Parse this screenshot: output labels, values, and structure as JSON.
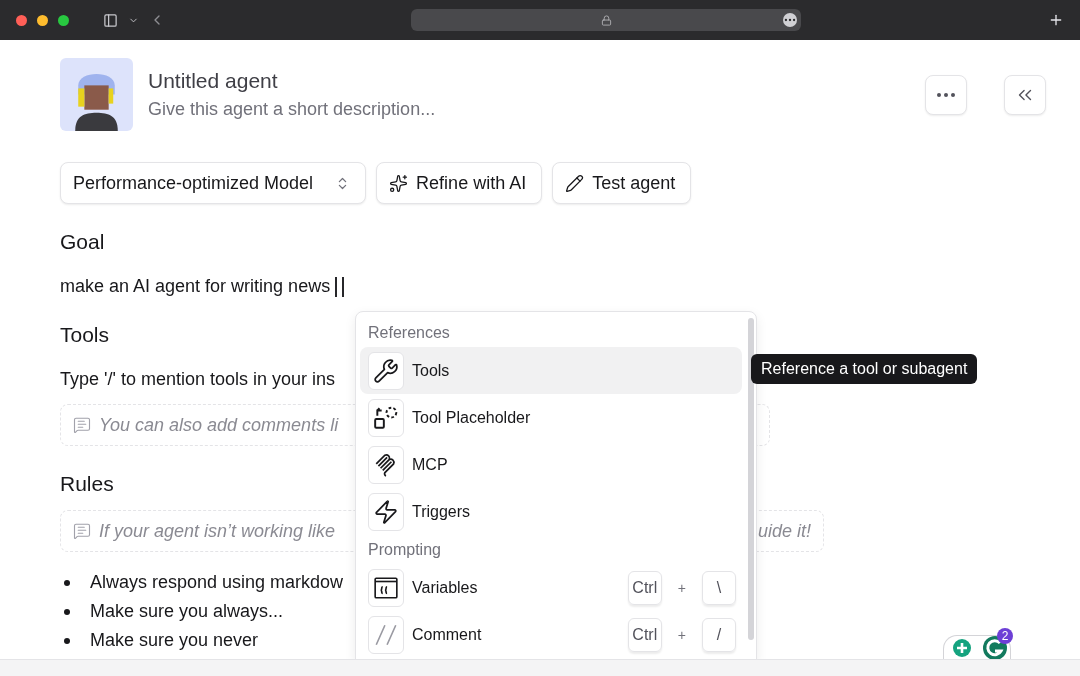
{
  "agent": {
    "title": "Untitled agent",
    "description": "Give this agent a short description..."
  },
  "toolbar": {
    "model": "Performance-optimized Model",
    "buttons": [
      {
        "kind": "sparkle",
        "label": "Refine with AI"
      },
      {
        "kind": "pencil",
        "label": "Test agent"
      }
    ]
  },
  "goal": {
    "heading": "Goal",
    "text": "make an AI agent for writing news"
  },
  "tools": {
    "heading": "Tools",
    "text": "Type '/' to mention tools in your ins",
    "comment": "You can also add comments li"
  },
  "rules": {
    "heading": "Rules",
    "comment_left": "If your agent isn’t working like",
    "comment_right": "uide it!",
    "bullets": [
      "Always respond using markdow",
      "Make sure you always...",
      "Make sure you never"
    ]
  },
  "menu": {
    "groups": [
      {
        "title": "References",
        "items": [
          {
            "kind": "wrench",
            "label": "Tools",
            "selected": true
          },
          {
            "kind": "placeholder",
            "label": "Tool Placeholder",
            "selected": false
          },
          {
            "kind": "mcp",
            "label": "MCP",
            "selected": false
          },
          {
            "kind": "bolt",
            "label": "Triggers",
            "selected": false
          }
        ]
      },
      {
        "title": "Prompting",
        "items": [
          {
            "kind": "braces",
            "label": "Variables",
            "selected": false,
            "keys": [
              "Ctrl",
              "\\"
            ],
            "joiner": "+"
          },
          {
            "kind": "slashes",
            "label": "Comment",
            "selected": false,
            "keys": [
              "Ctrl",
              "/"
            ],
            "joiner": "+"
          }
        ]
      }
    ]
  },
  "tooltip": "Reference a tool or subagent",
  "grammarly": {
    "count": "2"
  }
}
